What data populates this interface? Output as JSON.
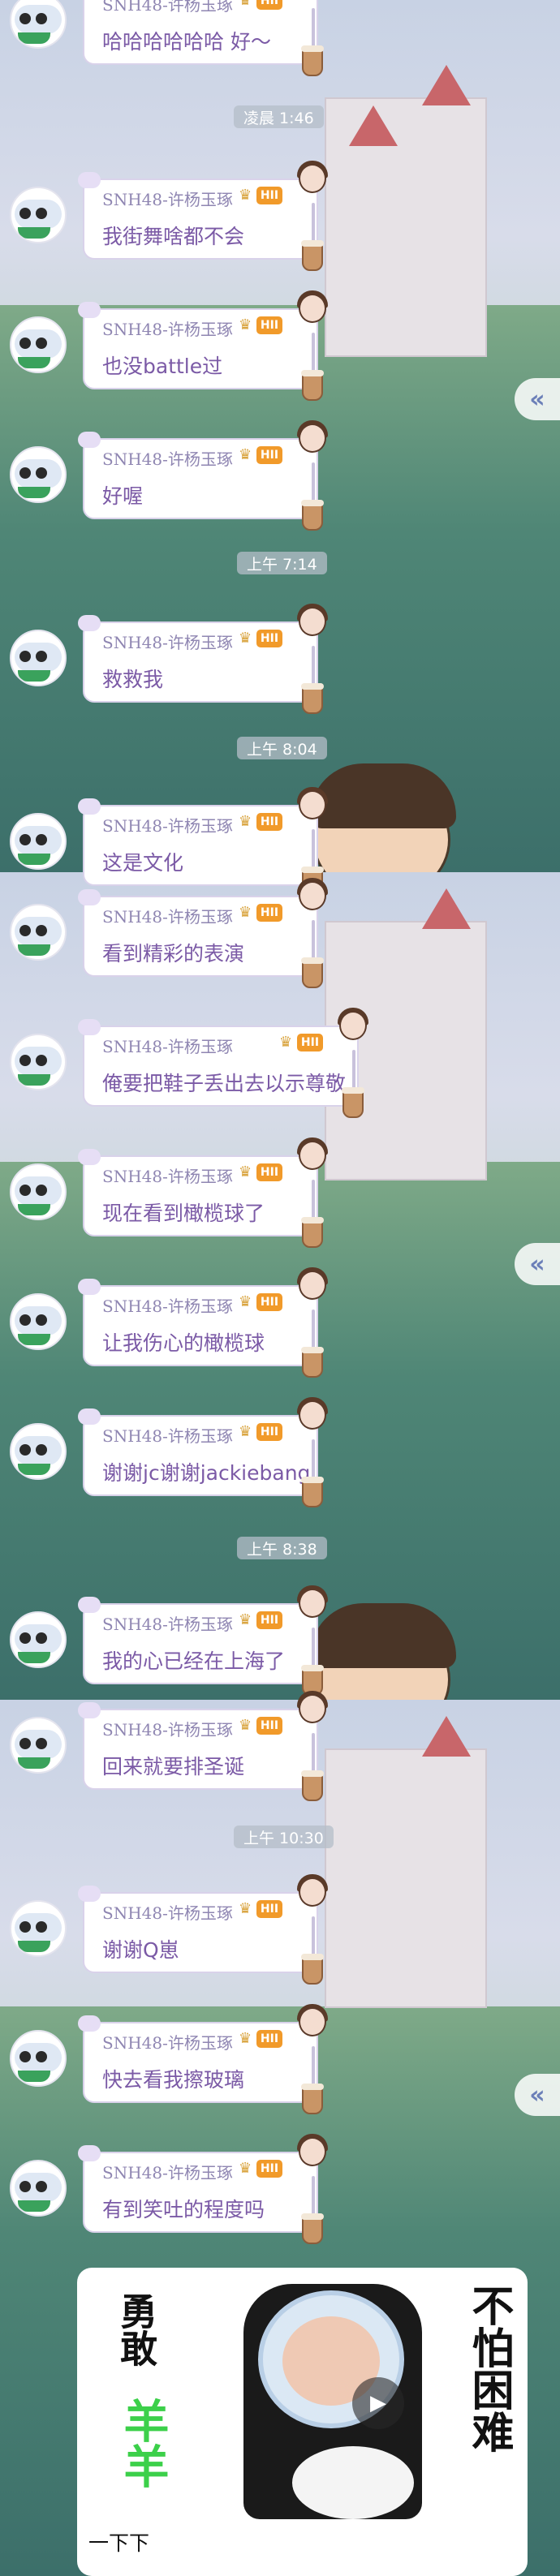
{
  "sender": {
    "name": "SNH48-许杨玉琢",
    "crown": "♛",
    "level": "HII"
  },
  "collapse_label": "«",
  "timestamps": [
    "凌晨 1:46",
    "上午 7:14",
    "上午 8:04",
    "上午 8:38",
    "上午 10:30"
  ],
  "messages": [
    {
      "text": "哈哈哈哈哈哈 好～"
    },
    {
      "text": "我街舞啥都不会"
    },
    {
      "text": "也没battle过"
    },
    {
      "text": "好喔"
    },
    {
      "text": "救救我"
    },
    {
      "text": "这是文化"
    },
    {
      "text": "看到精彩的表演"
    },
    {
      "text": "俺要把鞋子丢出去以示尊敬"
    },
    {
      "text": "现在看到橄榄球了"
    },
    {
      "text": "让我伤心的橄榄球"
    },
    {
      "text": "谢谢jc谢谢jackiebang"
    },
    {
      "text": "我的心已经在上海了"
    },
    {
      "text": "回来就要排圣诞"
    },
    {
      "text": "谢谢Q崽"
    },
    {
      "text": "快去看我擦玻璃"
    },
    {
      "text": "有到笑吐的程度吗"
    }
  ],
  "sticker": {
    "left_text_top": "勇敢",
    "left_text_bottom": "羊羊",
    "right_text": "不怕困难"
  },
  "video_icon": "video-camera-icon",
  "media_caption": "一下下",
  "colors": {
    "level_badge": "#f19a2a",
    "name": "#8f86b2",
    "message_text": "#7b5aa6"
  }
}
